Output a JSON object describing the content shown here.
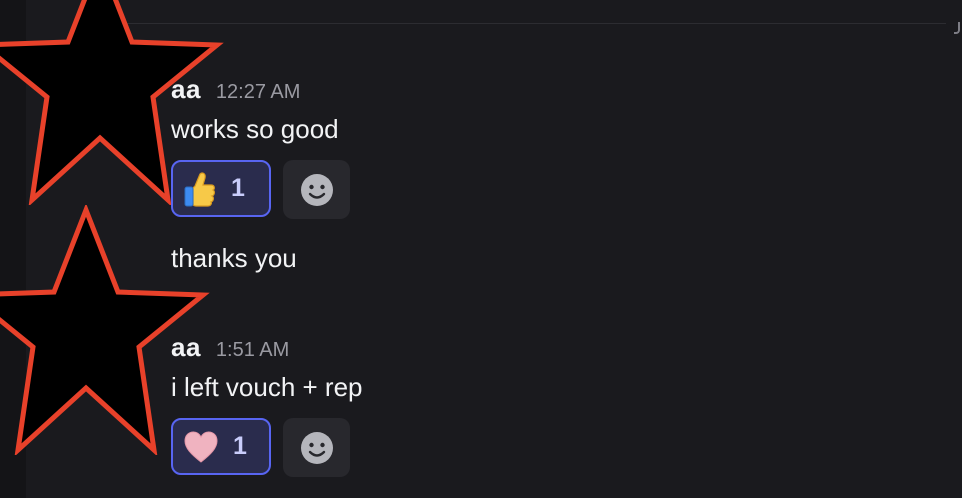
{
  "messages": [
    {
      "author": "aa",
      "timestamp": "12:27 AM",
      "lines": [
        "works so good",
        "thanks you"
      ],
      "reaction": {
        "emoji": "thumbs-up-icon",
        "count": "1"
      }
    },
    {
      "author": "aa",
      "timestamp": "1:51 AM",
      "lines": [
        "i left vouch + rep"
      ],
      "reaction": {
        "emoji": "heart-icon",
        "count": "1"
      }
    }
  ],
  "colors": {
    "background": "#1a1a1e",
    "reaction_border": "#5865f2",
    "reaction_fill": "#2a2c4d",
    "avatar_outline": "#e8412a"
  },
  "icons": [
    "star-avatar-icon",
    "thumbs-up-icon",
    "heart-icon",
    "add-reaction-icon"
  ]
}
